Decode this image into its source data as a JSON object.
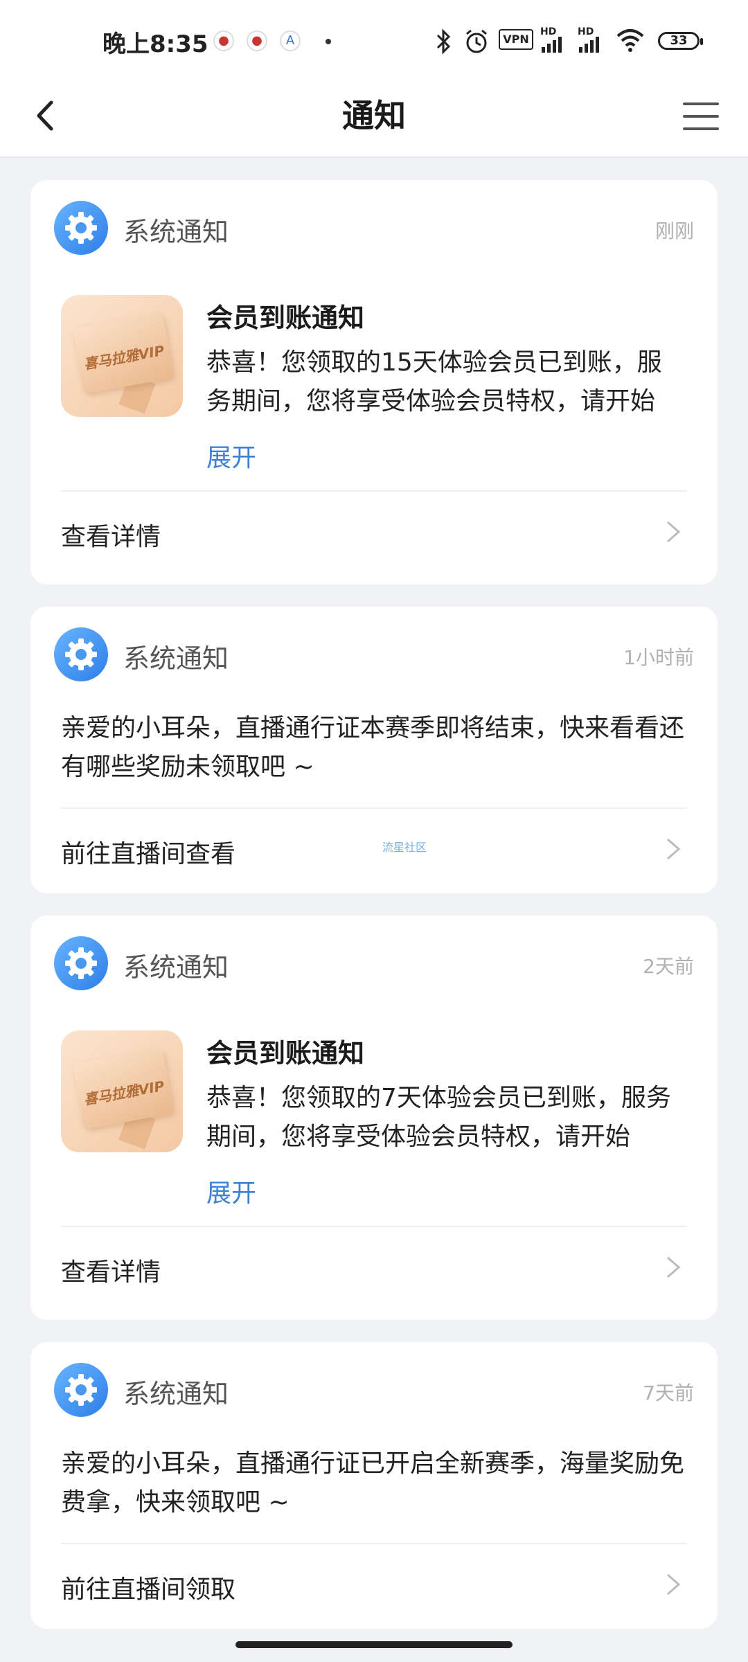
{
  "status_bar": {
    "time": "晚上8:35",
    "vpn": "VPN",
    "hd1": "HD",
    "hd2": "HD",
    "battery": "33"
  },
  "nav": {
    "title": "通知"
  },
  "notifications": [
    {
      "label": "系统通知",
      "time": "刚刚",
      "title": "会员到账通知",
      "body": "恭喜！您领取的15天体验会员已到账，服务期间，您将享受体验会员特权，请开始",
      "expand": "展开",
      "action": "查看详情",
      "vip_text": "喜马拉雅VIP"
    },
    {
      "label": "系统通知",
      "time": "1小时前",
      "body": "亲爱的小耳朵，直播通行证本赛季即将结束，快来看看还有哪些奖励未领取吧 ~",
      "action": "前往直播间查看",
      "watermark": "流星社区"
    },
    {
      "label": "系统通知",
      "time": "2天前",
      "title": "会员到账通知",
      "body": "恭喜！您领取的7天体验会员已到账，服务期间，您将享受体验会员特权，请开始",
      "expand": "展开",
      "action": "查看详情",
      "vip_text": "喜马拉雅VIP"
    },
    {
      "label": "系统通知",
      "time": "7天前",
      "body": "亲爱的小耳朵，直播通行证已开启全新赛季，海量奖励免费拿，快来领取吧 ~",
      "action": "前往直播间领取"
    }
  ]
}
